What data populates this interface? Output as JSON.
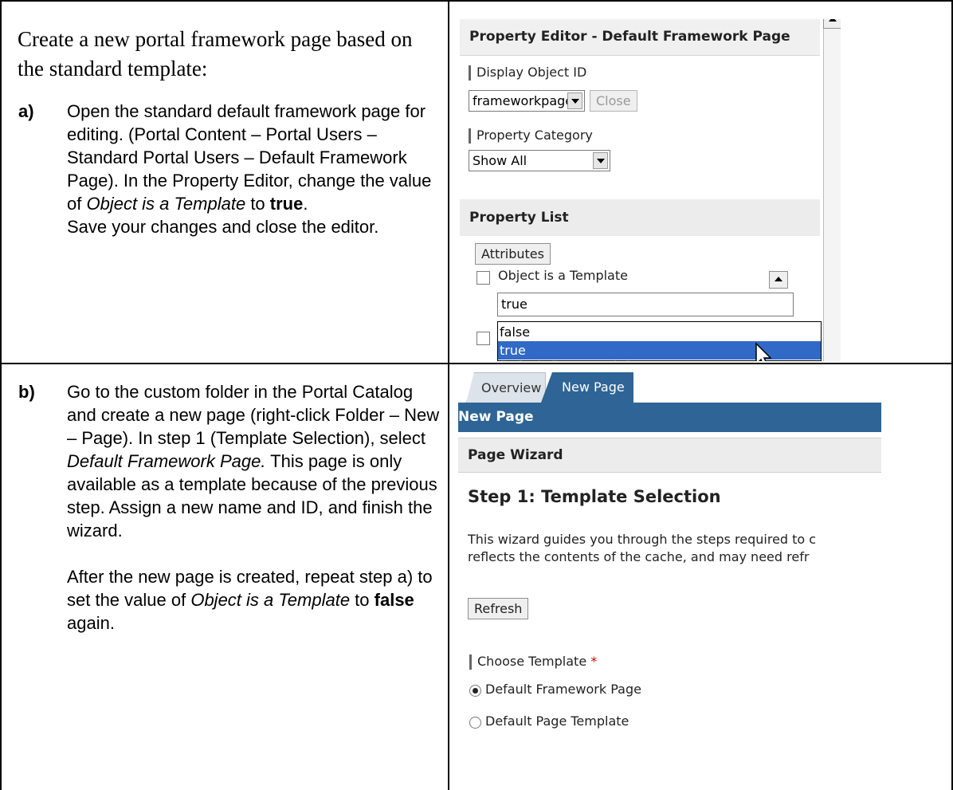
{
  "intro": "Create a new portal framework page based on the standard template:",
  "step_a": {
    "letter": "a)",
    "t1": "Open the standard default framework page for editing. (Portal Content – Portal Users – Standard Portal Users – Default Framework Page). In the Property Editor, change the value of ",
    "t2": "Object is a Template",
    "t3": " to ",
    "t4": "true",
    "t5": ".",
    "t6": "Save your changes and close the editor."
  },
  "step_b": {
    "letter": "b)",
    "t1": "Go to the custom folder in the Portal Catalog and create a new page (right-click Folder – New – Page). In step 1 (Template Selection), select ",
    "t2": "Default Framework Page.",
    "t3": " This page is only available as a template because of the previous step. Assign a new name and ID, and finish the wizard.",
    "t4": "After the new page is created, repeat step a) to set the value of ",
    "t5": "Object is a Template",
    "t6": " to ",
    "t7": "false",
    "t8": " again."
  },
  "property_editor": {
    "header": "Property Editor - Default Framework Page",
    "display_object_label": "Display Object ID",
    "display_object_value": "frameworkpage",
    "close_label": "Close",
    "category_label": "Property Category",
    "category_value": "Show All",
    "list_header": "Property List",
    "attributes_label": "Attributes",
    "object_template_label": "Object is a Template",
    "object_template_value": "true",
    "options": [
      "false",
      "true"
    ],
    "behind_text": "Default Framework Page"
  },
  "wizard": {
    "tab_overview": "Overview",
    "tab_new": "New Page",
    "title": "New Page",
    "header": "Page Wizard",
    "step_title": "Step 1: Template Selection",
    "desc_line1": "This wizard guides you through the steps required to c",
    "desc_line2": "reflects the contents of the cache, and may need refr",
    "refresh_label": "Refresh",
    "choose_label": "Choose Template",
    "required_mark": "*",
    "template_options": [
      "Default Framework Page",
      "Default Page Template"
    ]
  }
}
